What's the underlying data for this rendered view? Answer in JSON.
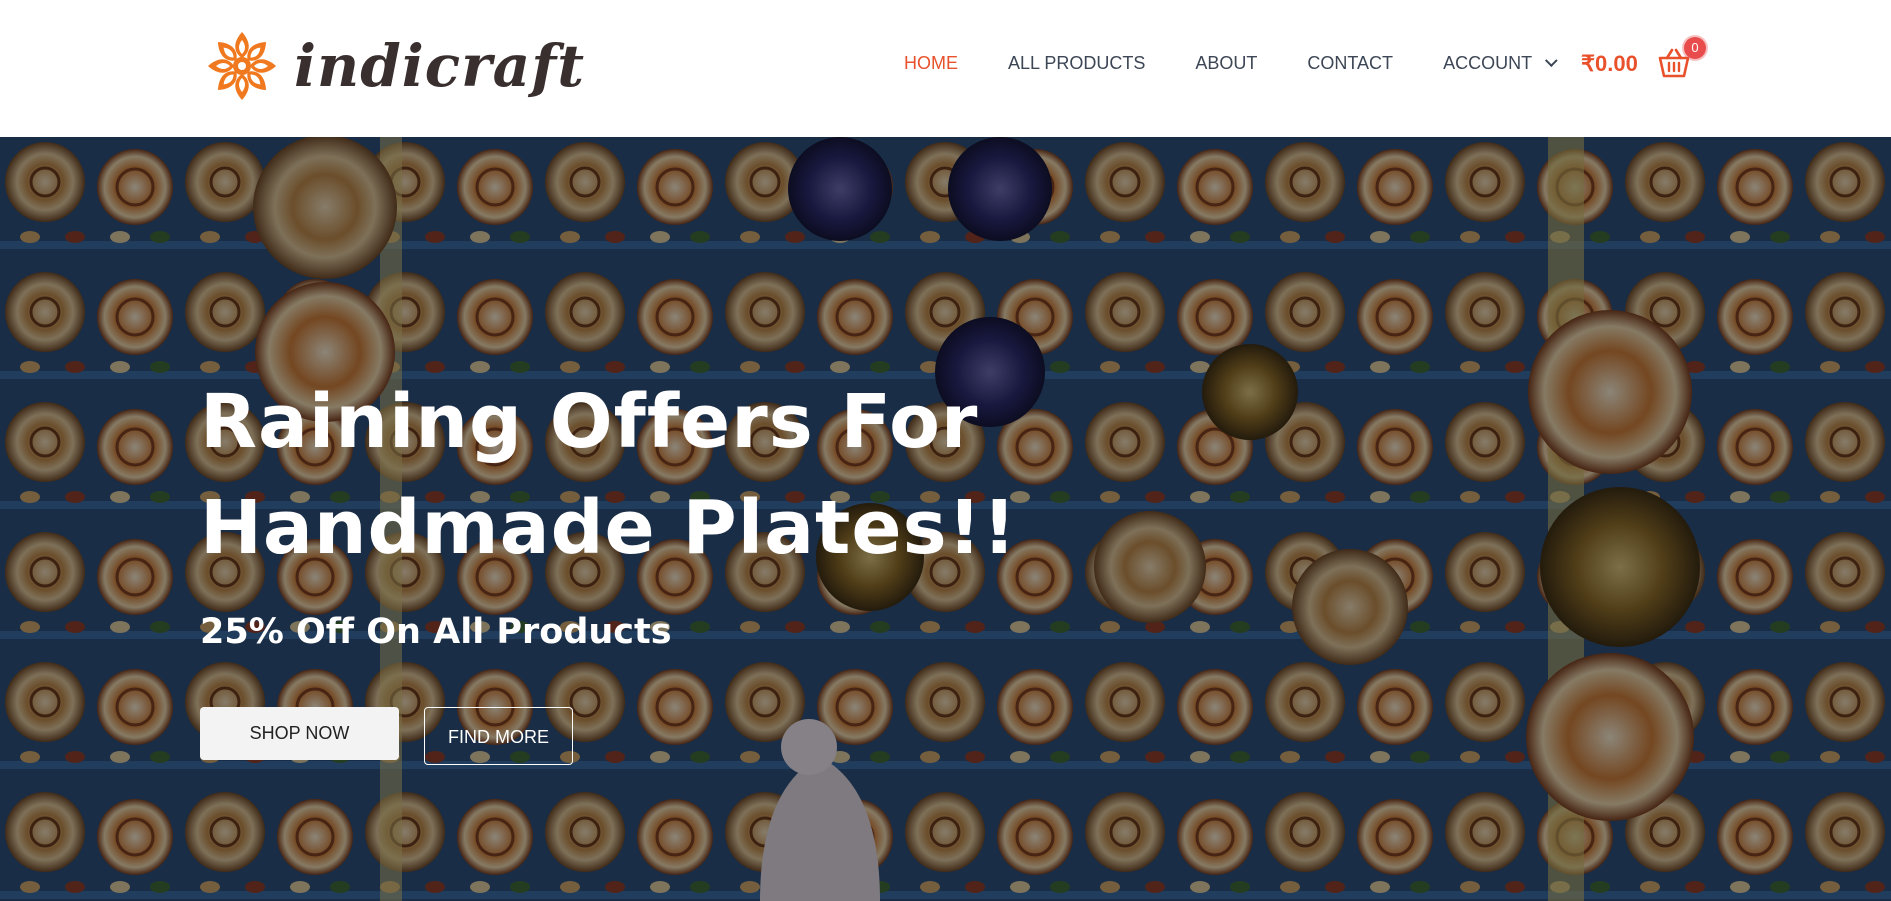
{
  "brand": {
    "name": "indicraft",
    "accent_color": "#e8512b",
    "logo_icon": "mandala-flower-icon"
  },
  "nav": {
    "items": [
      {
        "label": "HOME",
        "active": true
      },
      {
        "label": "ALL PRODUCTS",
        "active": false
      },
      {
        "label": "ABOUT",
        "active": false
      },
      {
        "label": "CONTACT",
        "active": false
      },
      {
        "label": "ACCOUNT",
        "active": false,
        "icon": "chevron-down-icon"
      }
    ]
  },
  "cart": {
    "total": "₹0.00",
    "count": "0",
    "icon": "shopping-basket-icon"
  },
  "hero": {
    "title_line1": "Raining Offers For",
    "title_line2": "Handmade Plates!!",
    "subtitle": "25% Off On All Products",
    "shop_button": "SHOP NOW",
    "find_button": "FIND MORE"
  }
}
